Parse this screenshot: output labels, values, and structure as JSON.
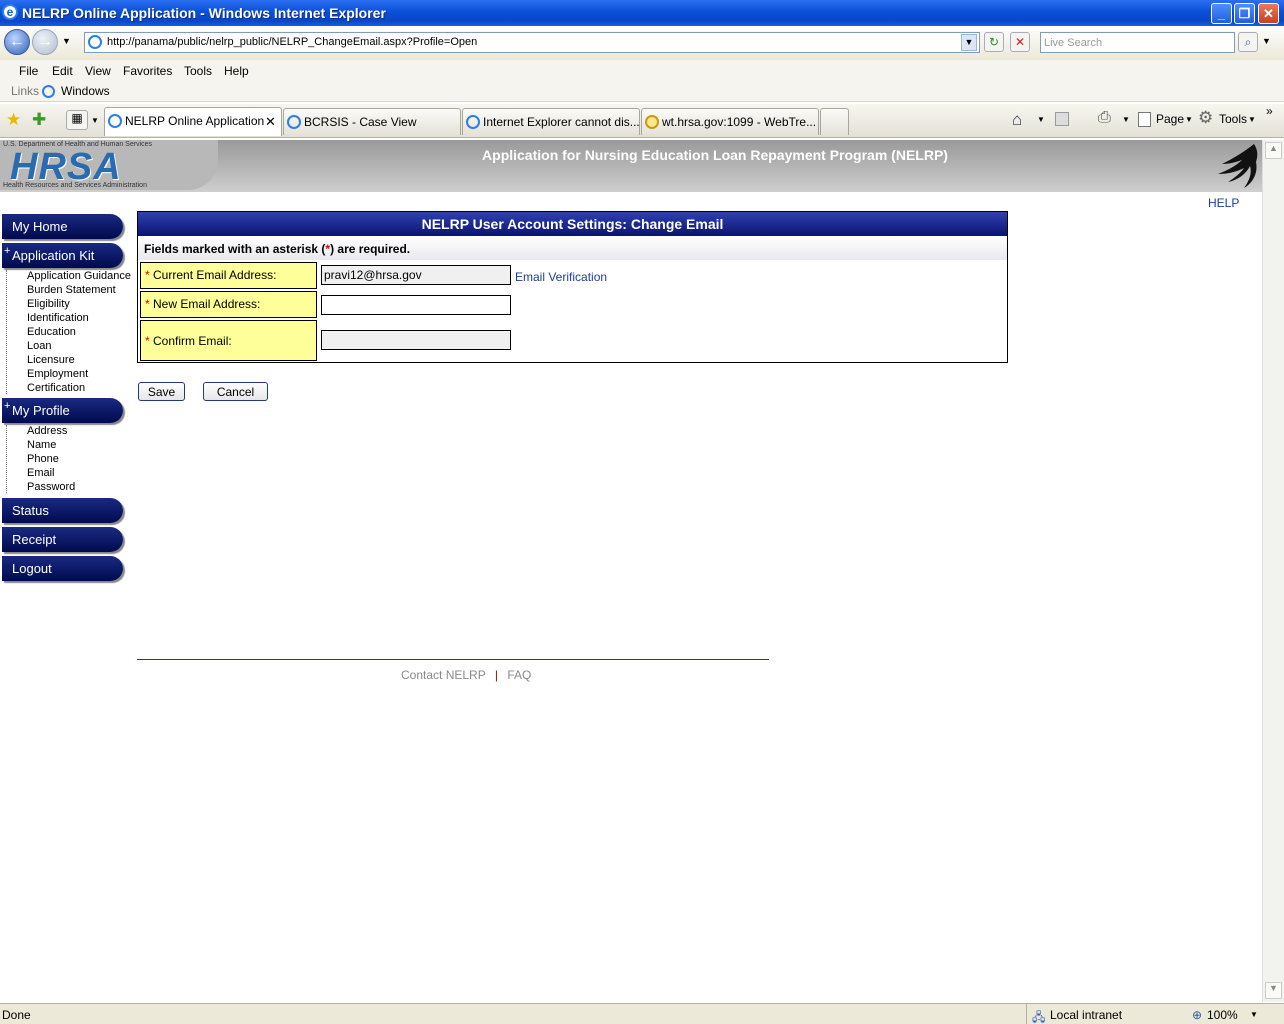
{
  "window": {
    "title": "NELRP Online Application - Windows Internet Explorer"
  },
  "browser": {
    "address": "http://panama/public/nelrp_public/NELRP_ChangeEmail.aspx?Profile=Open",
    "search_placeholder": "Live Search",
    "menu": [
      "File",
      "Edit",
      "View",
      "Favorites",
      "Tools",
      "Help"
    ],
    "links_label": "Links",
    "links_item": "Windows",
    "tabs": [
      {
        "label": "NELRP Online Application",
        "active": true
      },
      {
        "label": "BCRSIS - Case View"
      },
      {
        "label": "Internet Explorer cannot dis..."
      },
      {
        "label": "wt.hrsa.gov:1099 - WebTre..."
      }
    ],
    "tools": {
      "page": "Page",
      "tools": "Tools"
    },
    "status": {
      "left": "Done",
      "zone": "Local intranet",
      "zoom": "100%"
    }
  },
  "header": {
    "dept": "U.S. Department of Health and Human Services",
    "logo": "HRSA",
    "logo_sub": "Health Resources and Services Administration",
    "title": "Application for Nursing Education Loan Repayment Program (NELRP)",
    "help": "HELP"
  },
  "sidebar": {
    "my_home": "My Home",
    "application_kit": "Application Kit",
    "kit_items": [
      "Application Guidance",
      "Burden Statement",
      "Eligibility",
      "Identification",
      "Education",
      "Loan",
      "Licensure",
      "Employment",
      "Certification"
    ],
    "my_profile": "My Profile",
    "profile_items": [
      "Address",
      "Name",
      "Phone",
      "Email",
      "Password"
    ],
    "status": "Status",
    "receipt": "Receipt",
    "logout": "Logout"
  },
  "form": {
    "heading": "NELRP User Account Settings: Change Email",
    "required_note_pre": "Fields marked with an asterisk (",
    "required_note_ast": "*",
    "required_note_post": ") are required.",
    "current_label": "Current Email Address:",
    "current_value": "pravi12@hrsa.gov",
    "verification_link": "Email Verification",
    "new_label": "New Email Address:",
    "new_value": "",
    "confirm_label": "Confirm Email:",
    "confirm_value": "",
    "save": "Save",
    "cancel": "Cancel"
  },
  "footer": {
    "contact": "Contact NELRP",
    "sep": "|",
    "faq": "FAQ"
  }
}
